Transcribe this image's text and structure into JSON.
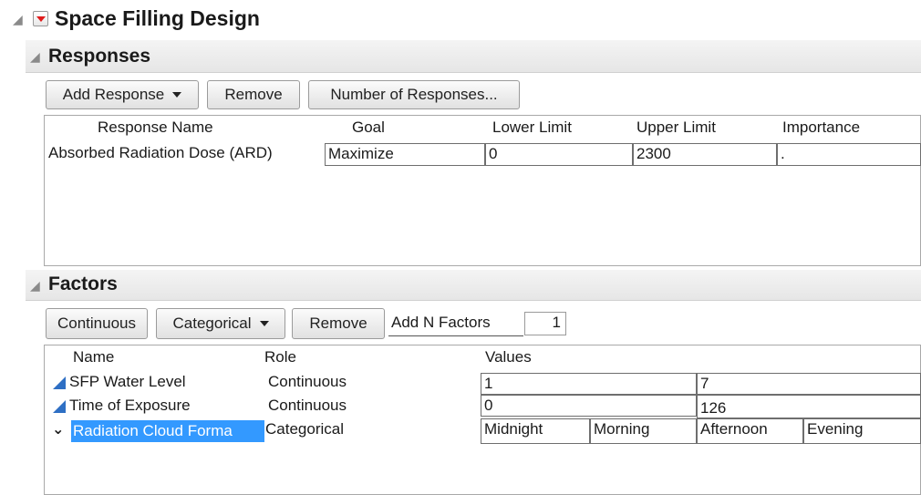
{
  "design": {
    "title": "Space Filling Design"
  },
  "responses": {
    "title": "Responses",
    "buttons": {
      "add_response": "Add Response",
      "remove": "Remove",
      "number_of_responses": "Number of Responses..."
    },
    "columns": [
      "Response Name",
      "Goal",
      "Lower Limit",
      "Upper Limit",
      "Importance"
    ],
    "rows": [
      {
        "name": "Absorbed Radiation Dose (ARD)",
        "goal": "Maximize",
        "lower": "0",
        "upper": "2300",
        "importance": "."
      }
    ]
  },
  "factors": {
    "title": "Factors",
    "buttons": {
      "continuous": "Continuous",
      "categorical": "Categorical",
      "remove": "Remove",
      "add_n_factors": "Add N Factors",
      "n_value": "1"
    },
    "columns": [
      "Name",
      "Role",
      "Values"
    ],
    "rows": [
      {
        "name": "SFP Water Level",
        "role": "Continuous",
        "values": [
          "1",
          "7"
        ]
      },
      {
        "name": "Time of Exposure",
        "role": "Continuous",
        "values": [
          "0",
          "126"
        ]
      },
      {
        "name": "Radiation Cloud Forma",
        "role": "Categorical",
        "values": [
          "Midnight",
          "Morning",
          "Afternoon",
          "Evening"
        ]
      }
    ]
  },
  "colors": {
    "accent_red": "#e01b1b",
    "continuous_icon": "#2e6fc4",
    "selection": "#3399ff"
  }
}
